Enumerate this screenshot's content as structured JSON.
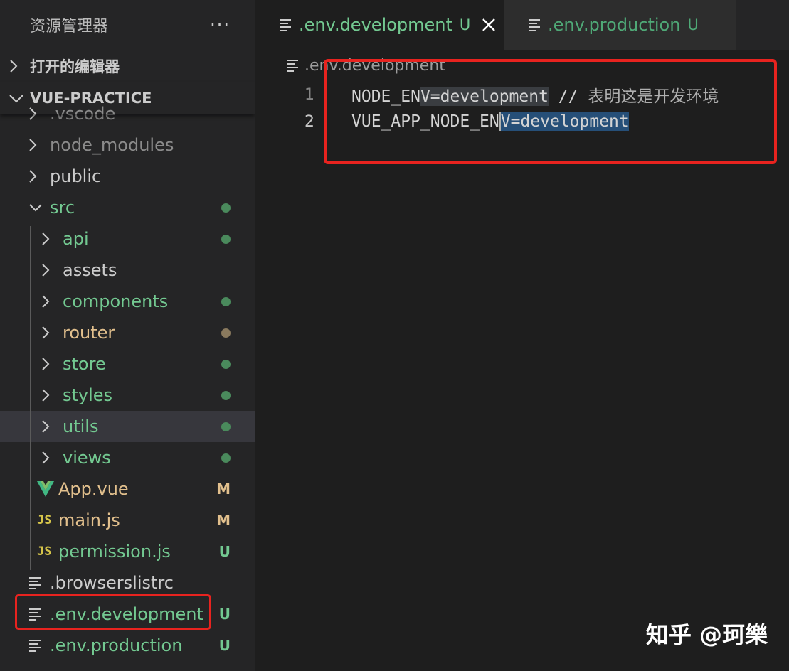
{
  "explorer": {
    "title": "资源管理器",
    "more": "···",
    "open_editors": "打开的编辑器",
    "project": "VUE-PRACTICE"
  },
  "tree": [
    {
      "label": ".vscode",
      "type": "folder",
      "depth": 0,
      "open": false,
      "color": "#8b8b8b"
    },
    {
      "label": "node_modules",
      "type": "folder",
      "depth": 0,
      "open": false,
      "color": "#8b8b8b"
    },
    {
      "label": "public",
      "type": "folder",
      "depth": 0,
      "open": false,
      "color": "#cccccc"
    },
    {
      "label": "src",
      "type": "folder",
      "depth": 0,
      "open": true,
      "color": "#73c991",
      "status": "dot",
      "status_color": "#4a8a5c"
    },
    {
      "label": "api",
      "type": "folder",
      "depth": 1,
      "open": false,
      "color": "#73c991",
      "status": "dot",
      "status_color": "#4a8a5c"
    },
    {
      "label": "assets",
      "type": "folder",
      "depth": 1,
      "open": false,
      "color": "#cccccc"
    },
    {
      "label": "components",
      "type": "folder",
      "depth": 1,
      "open": false,
      "color": "#73c991",
      "status": "dot",
      "status_color": "#4a8a5c"
    },
    {
      "label": "router",
      "type": "folder",
      "depth": 1,
      "open": false,
      "color": "#e2c08d",
      "status": "dot",
      "status_color": "#8a7a5e"
    },
    {
      "label": "store",
      "type": "folder",
      "depth": 1,
      "open": false,
      "color": "#73c991",
      "status": "dot",
      "status_color": "#4a8a5c"
    },
    {
      "label": "styles",
      "type": "folder",
      "depth": 1,
      "open": false,
      "color": "#73c991",
      "status": "dot",
      "status_color": "#4a8a5c"
    },
    {
      "label": "utils",
      "type": "folder",
      "depth": 1,
      "open": false,
      "color": "#73c991",
      "status": "dot",
      "status_color": "#4a8a5c",
      "selected": true
    },
    {
      "label": "views",
      "type": "folder",
      "depth": 1,
      "open": false,
      "color": "#73c991",
      "status": "dot",
      "status_color": "#4a8a5c"
    },
    {
      "label": "App.vue",
      "type": "vue",
      "depth": 1,
      "color": "#e2c08d",
      "status": "M",
      "status_color": "#e2c08d"
    },
    {
      "label": "main.js",
      "type": "js",
      "depth": 1,
      "color": "#e2c08d",
      "status": "M",
      "status_color": "#e2c08d"
    },
    {
      "label": "permission.js",
      "type": "js",
      "depth": 1,
      "color": "#73c991",
      "status": "U",
      "status_color": "#73c991"
    },
    {
      "label": ".browserslistrc",
      "type": "text",
      "depth": 0,
      "color": "#cccccc"
    },
    {
      "label": ".env.development",
      "type": "text",
      "depth": 0,
      "color": "#73c991",
      "status": "U",
      "status_color": "#73c991"
    },
    {
      "label": ".env.production",
      "type": "text",
      "depth": 0,
      "color": "#73c991",
      "status": "U",
      "status_color": "#73c991"
    }
  ],
  "tabs": [
    {
      "label": ".env.development",
      "status": "U",
      "active": true
    },
    {
      "label": ".env.production",
      "status": "U",
      "active": false
    }
  ],
  "breadcrumb": ".env.development",
  "code": {
    "line1": {
      "num": "1",
      "pre": "NODE_EN",
      "hl": "V=development",
      "mid": " // ",
      "comment": "表明这是开发环境"
    },
    "line2": {
      "num": "2",
      "pre": "VUE_APP_NODE_EN",
      "hl": "V=development"
    }
  },
  "watermark": "知乎 @珂樂"
}
